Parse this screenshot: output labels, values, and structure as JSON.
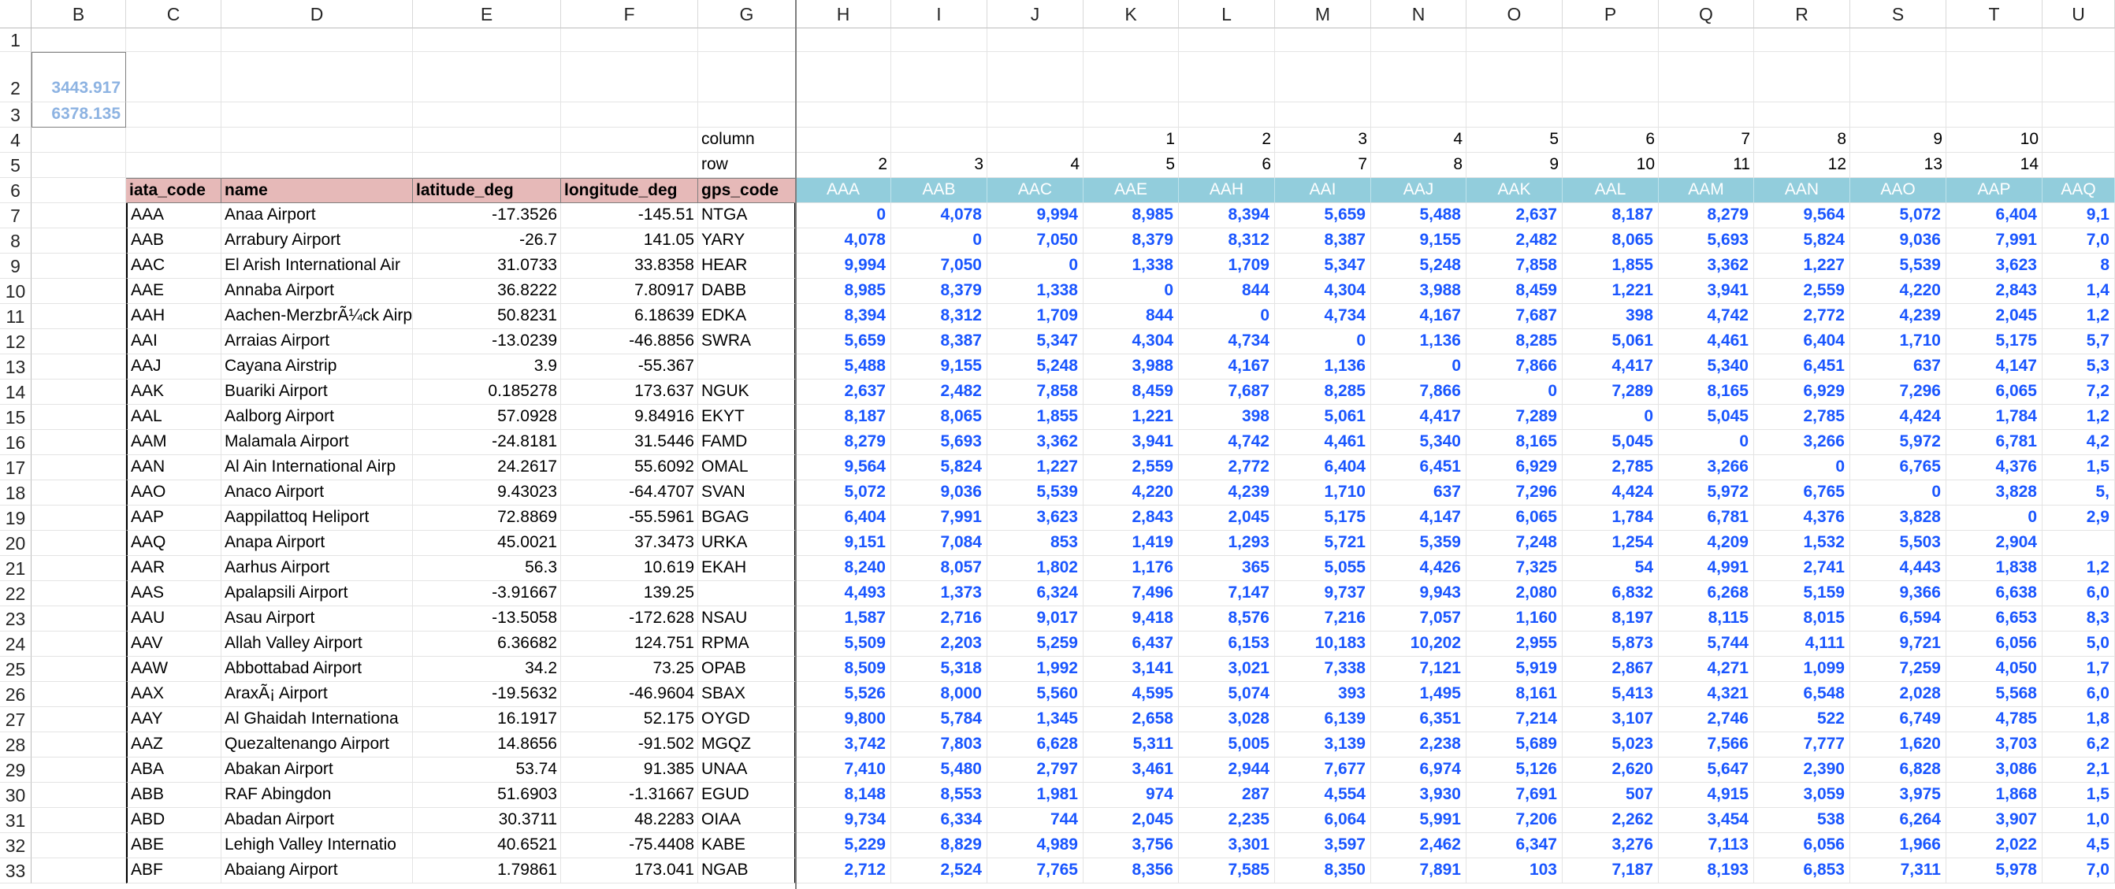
{
  "columns": [
    "B",
    "C",
    "D",
    "E",
    "F",
    "G",
    "H",
    "I",
    "J",
    "K",
    "L",
    "M",
    "N",
    "O",
    "P",
    "Q",
    "R",
    "S",
    "T",
    "U"
  ],
  "row_numbers": [
    "1",
    "2",
    "3",
    "4",
    "5",
    "6",
    "7",
    "8",
    "9",
    "10",
    "11",
    "12",
    "13",
    "14",
    "15",
    "16",
    "17",
    "18",
    "19",
    "20",
    "21",
    "22",
    "23",
    "24",
    "25",
    "26",
    "27",
    "28",
    "29",
    "30",
    "31",
    "32",
    "33"
  ],
  "constants": {
    "b2": "3443.917",
    "b3": "6378.135"
  },
  "labels": {
    "column": "column",
    "row": "row"
  },
  "column_index_row": [
    "",
    "",
    "",
    "1",
    "2",
    "3",
    "4",
    "5",
    "6",
    "7",
    "8",
    "9",
    "10",
    ""
  ],
  "row_index_row": [
    "2",
    "3",
    "4",
    "5",
    "6",
    "7",
    "8",
    "9",
    "10",
    "11",
    "12",
    "13",
    "14",
    ""
  ],
  "headers": {
    "iata": "iata_code",
    "name": "name",
    "lat": "latitude_deg",
    "lon": "longitude_deg",
    "gps": "gps_code"
  },
  "matrix_headers": [
    "AAA",
    "AAB",
    "AAC",
    "AAE",
    "AAH",
    "AAI",
    "AAJ",
    "AAK",
    "AAL",
    "AAM",
    "AAN",
    "AAO",
    "AAP",
    "AAQ"
  ],
  "airports": [
    {
      "iata": "AAA",
      "name": "Anaa Airport",
      "lat": "-17.3526",
      "lon": "-145.51",
      "gps": "NTGA"
    },
    {
      "iata": "AAB",
      "name": "Arrabury Airport",
      "lat": "-26.7",
      "lon": "141.05",
      "gps": "YARY"
    },
    {
      "iata": "AAC",
      "name": "El Arish International Air",
      "lat": "31.0733",
      "lon": "33.8358",
      "gps": "HEAR"
    },
    {
      "iata": "AAE",
      "name": "Annaba Airport",
      "lat": "36.8222",
      "lon": "7.80917",
      "gps": "DABB"
    },
    {
      "iata": "AAH",
      "name": "Aachen-MerzbrÃ¼ck Airp",
      "lat": "50.8231",
      "lon": "6.18639",
      "gps": "EDKA"
    },
    {
      "iata": "AAI",
      "name": "Arraias Airport",
      "lat": "-13.0239",
      "lon": "-46.8856",
      "gps": "SWRA"
    },
    {
      "iata": "AAJ",
      "name": "Cayana Airstrip",
      "lat": "3.9",
      "lon": "-55.367",
      "gps": ""
    },
    {
      "iata": "AAK",
      "name": "Buariki Airport",
      "lat": "0.185278",
      "lon": "173.637",
      "gps": "NGUK"
    },
    {
      "iata": "AAL",
      "name": "Aalborg Airport",
      "lat": "57.0928",
      "lon": "9.84916",
      "gps": "EKYT"
    },
    {
      "iata": "AAM",
      "name": "Malamala Airport",
      "lat": "-24.8181",
      "lon": "31.5446",
      "gps": "FAMD"
    },
    {
      "iata": "AAN",
      "name": "Al Ain International Airp",
      "lat": "24.2617",
      "lon": "55.6092",
      "gps": "OMAL"
    },
    {
      "iata": "AAO",
      "name": "Anaco Airport",
      "lat": "9.43023",
      "lon": "-64.4707",
      "gps": "SVAN"
    },
    {
      "iata": "AAP",
      "name": "Aappilattoq Heliport",
      "lat": "72.8869",
      "lon": "-55.5961",
      "gps": "BGAG"
    },
    {
      "iata": "AAQ",
      "name": "Anapa Airport",
      "lat": "45.0021",
      "lon": "37.3473",
      "gps": "URKA"
    },
    {
      "iata": "AAR",
      "name": "Aarhus Airport",
      "lat": "56.3",
      "lon": "10.619",
      "gps": "EKAH"
    },
    {
      "iata": "AAS",
      "name": "Apalapsili Airport",
      "lat": "-3.91667",
      "lon": "139.25",
      "gps": ""
    },
    {
      "iata": "AAU",
      "name": "Asau Airport",
      "lat": "-13.5058",
      "lon": "-172.628",
      "gps": "NSAU"
    },
    {
      "iata": "AAV",
      "name": "Allah Valley Airport",
      "lat": "6.36682",
      "lon": "124.751",
      "gps": "RPMA"
    },
    {
      "iata": "AAW",
      "name": "Abbottabad Airport",
      "lat": "34.2",
      "lon": "73.25",
      "gps": "OPAB"
    },
    {
      "iata": "AAX",
      "name": "AraxÃ¡ Airport",
      "lat": "-19.5632",
      "lon": "-46.9604",
      "gps": "SBAX"
    },
    {
      "iata": "AAY",
      "name": "Al Ghaidah Internationa",
      "lat": "16.1917",
      "lon": "52.175",
      "gps": "OYGD"
    },
    {
      "iata": "AAZ",
      "name": "Quezaltenango Airport",
      "lat": "14.8656",
      "lon": "-91.502",
      "gps": "MGQZ"
    },
    {
      "iata": "ABA",
      "name": "Abakan Airport",
      "lat": "53.74",
      "lon": "91.385",
      "gps": "UNAA"
    },
    {
      "iata": "ABB",
      "name": "RAF Abingdon",
      "lat": "51.6903",
      "lon": "-1.31667",
      "gps": "EGUD"
    },
    {
      "iata": "ABD",
      "name": "Abadan Airport",
      "lat": "30.3711",
      "lon": "48.2283",
      "gps": "OIAA"
    },
    {
      "iata": "ABE",
      "name": "Lehigh Valley Internatio",
      "lat": "40.6521",
      "lon": "-75.4408",
      "gps": "KABE"
    },
    {
      "iata": "ABF",
      "name": "Abaiang Airport",
      "lat": "1.79861",
      "lon": "173.041",
      "gps": "NGAB"
    }
  ],
  "distances": [
    [
      "0",
      "4,078",
      "9,994",
      "8,985",
      "8,394",
      "5,659",
      "5,488",
      "2,637",
      "8,187",
      "8,279",
      "9,564",
      "5,072",
      "6,404",
      "9,1"
    ],
    [
      "4,078",
      "0",
      "7,050",
      "8,379",
      "8,312",
      "8,387",
      "9,155",
      "2,482",
      "8,065",
      "5,693",
      "5,824",
      "9,036",
      "7,991",
      "7,0"
    ],
    [
      "9,994",
      "7,050",
      "0",
      "1,338",
      "1,709",
      "5,347",
      "5,248",
      "7,858",
      "1,855",
      "3,362",
      "1,227",
      "5,539",
      "3,623",
      "8"
    ],
    [
      "8,985",
      "8,379",
      "1,338",
      "0",
      "844",
      "4,304",
      "3,988",
      "8,459",
      "1,221",
      "3,941",
      "2,559",
      "4,220",
      "2,843",
      "1,4"
    ],
    [
      "8,394",
      "8,312",
      "1,709",
      "844",
      "0",
      "4,734",
      "4,167",
      "7,687",
      "398",
      "4,742",
      "2,772",
      "4,239",
      "2,045",
      "1,2"
    ],
    [
      "5,659",
      "8,387",
      "5,347",
      "4,304",
      "4,734",
      "0",
      "1,136",
      "8,285",
      "5,061",
      "4,461",
      "6,404",
      "1,710",
      "5,175",
      "5,7"
    ],
    [
      "5,488",
      "9,155",
      "5,248",
      "3,988",
      "4,167",
      "1,136",
      "0",
      "7,866",
      "4,417",
      "5,340",
      "6,451",
      "637",
      "4,147",
      "5,3"
    ],
    [
      "2,637",
      "2,482",
      "7,858",
      "8,459",
      "7,687",
      "8,285",
      "7,866",
      "0",
      "7,289",
      "8,165",
      "6,929",
      "7,296",
      "6,065",
      "7,2"
    ],
    [
      "8,187",
      "8,065",
      "1,855",
      "1,221",
      "398",
      "5,061",
      "4,417",
      "7,289",
      "0",
      "5,045",
      "2,785",
      "4,424",
      "1,784",
      "1,2"
    ],
    [
      "8,279",
      "5,693",
      "3,362",
      "3,941",
      "4,742",
      "4,461",
      "5,340",
      "8,165",
      "5,045",
      "0",
      "3,266",
      "5,972",
      "6,781",
      "4,2"
    ],
    [
      "9,564",
      "5,824",
      "1,227",
      "2,559",
      "2,772",
      "6,404",
      "6,451",
      "6,929",
      "2,785",
      "3,266",
      "0",
      "6,765",
      "4,376",
      "1,5"
    ],
    [
      "5,072",
      "9,036",
      "5,539",
      "4,220",
      "4,239",
      "1,710",
      "637",
      "7,296",
      "4,424",
      "5,972",
      "6,765",
      "0",
      "3,828",
      "5,"
    ],
    [
      "6,404",
      "7,991",
      "3,623",
      "2,843",
      "2,045",
      "5,175",
      "4,147",
      "6,065",
      "1,784",
      "6,781",
      "4,376",
      "3,828",
      "0",
      "2,9"
    ],
    [
      "9,151",
      "7,084",
      "853",
      "1,419",
      "1,293",
      "5,721",
      "5,359",
      "7,248",
      "1,254",
      "4,209",
      "1,532",
      "5,503",
      "2,904",
      ""
    ],
    [
      "8,240",
      "8,057",
      "1,802",
      "1,176",
      "365",
      "5,055",
      "4,426",
      "7,325",
      "54",
      "4,991",
      "2,741",
      "4,443",
      "1,838",
      "1,2"
    ],
    [
      "4,493",
      "1,373",
      "6,324",
      "7,496",
      "7,147",
      "9,737",
      "9,943",
      "2,080",
      "6,832",
      "6,268",
      "5,159",
      "9,366",
      "6,638",
      "6,0"
    ],
    [
      "1,587",
      "2,716",
      "9,017",
      "9,418",
      "8,576",
      "7,216",
      "7,057",
      "1,160",
      "8,197",
      "8,115",
      "8,015",
      "6,594",
      "6,653",
      "8,3"
    ],
    [
      "5,509",
      "2,203",
      "5,259",
      "6,437",
      "6,153",
      "10,183",
      "10,202",
      "2,955",
      "5,873",
      "5,744",
      "4,111",
      "9,721",
      "6,056",
      "5,0"
    ],
    [
      "8,509",
      "5,318",
      "1,992",
      "3,141",
      "3,021",
      "7,338",
      "7,121",
      "5,919",
      "2,867",
      "4,271",
      "1,099",
      "7,259",
      "4,050",
      "1,7"
    ],
    [
      "5,526",
      "8,000",
      "5,560",
      "4,595",
      "5,074",
      "393",
      "1,495",
      "8,161",
      "5,413",
      "4,321",
      "6,548",
      "2,028",
      "5,568",
      "6,0"
    ],
    [
      "9,800",
      "5,784",
      "1,345",
      "2,658",
      "3,028",
      "6,139",
      "6,351",
      "7,214",
      "3,107",
      "2,746",
      "522",
      "6,749",
      "4,785",
      "1,8"
    ],
    [
      "3,742",
      "7,803",
      "6,628",
      "5,311",
      "5,005",
      "3,139",
      "2,238",
      "5,689",
      "5,023",
      "7,566",
      "7,777",
      "1,620",
      "3,703",
      "6,2"
    ],
    [
      "7,410",
      "5,480",
      "2,797",
      "3,461",
      "2,944",
      "7,677",
      "6,974",
      "5,126",
      "2,620",
      "5,647",
      "2,390",
      "6,828",
      "3,086",
      "2,1"
    ],
    [
      "8,148",
      "8,553",
      "1,981",
      "974",
      "287",
      "4,554",
      "3,930",
      "7,691",
      "507",
      "4,915",
      "3,059",
      "3,975",
      "1,868",
      "1,5"
    ],
    [
      "9,734",
      "6,334",
      "744",
      "2,045",
      "2,235",
      "6,064",
      "5,991",
      "7,206",
      "2,262",
      "3,454",
      "538",
      "6,264",
      "3,907",
      "1,0"
    ],
    [
      "5,229",
      "8,829",
      "4,989",
      "3,756",
      "3,301",
      "3,597",
      "2,462",
      "6,347",
      "3,276",
      "7,113",
      "6,056",
      "1,966",
      "2,022",
      "4,5"
    ],
    [
      "2,712",
      "2,524",
      "7,765",
      "8,356",
      "7,585",
      "8,350",
      "7,891",
      "103",
      "7,187",
      "8,193",
      "6,853",
      "7,311",
      "5,978",
      "7,0"
    ]
  ]
}
